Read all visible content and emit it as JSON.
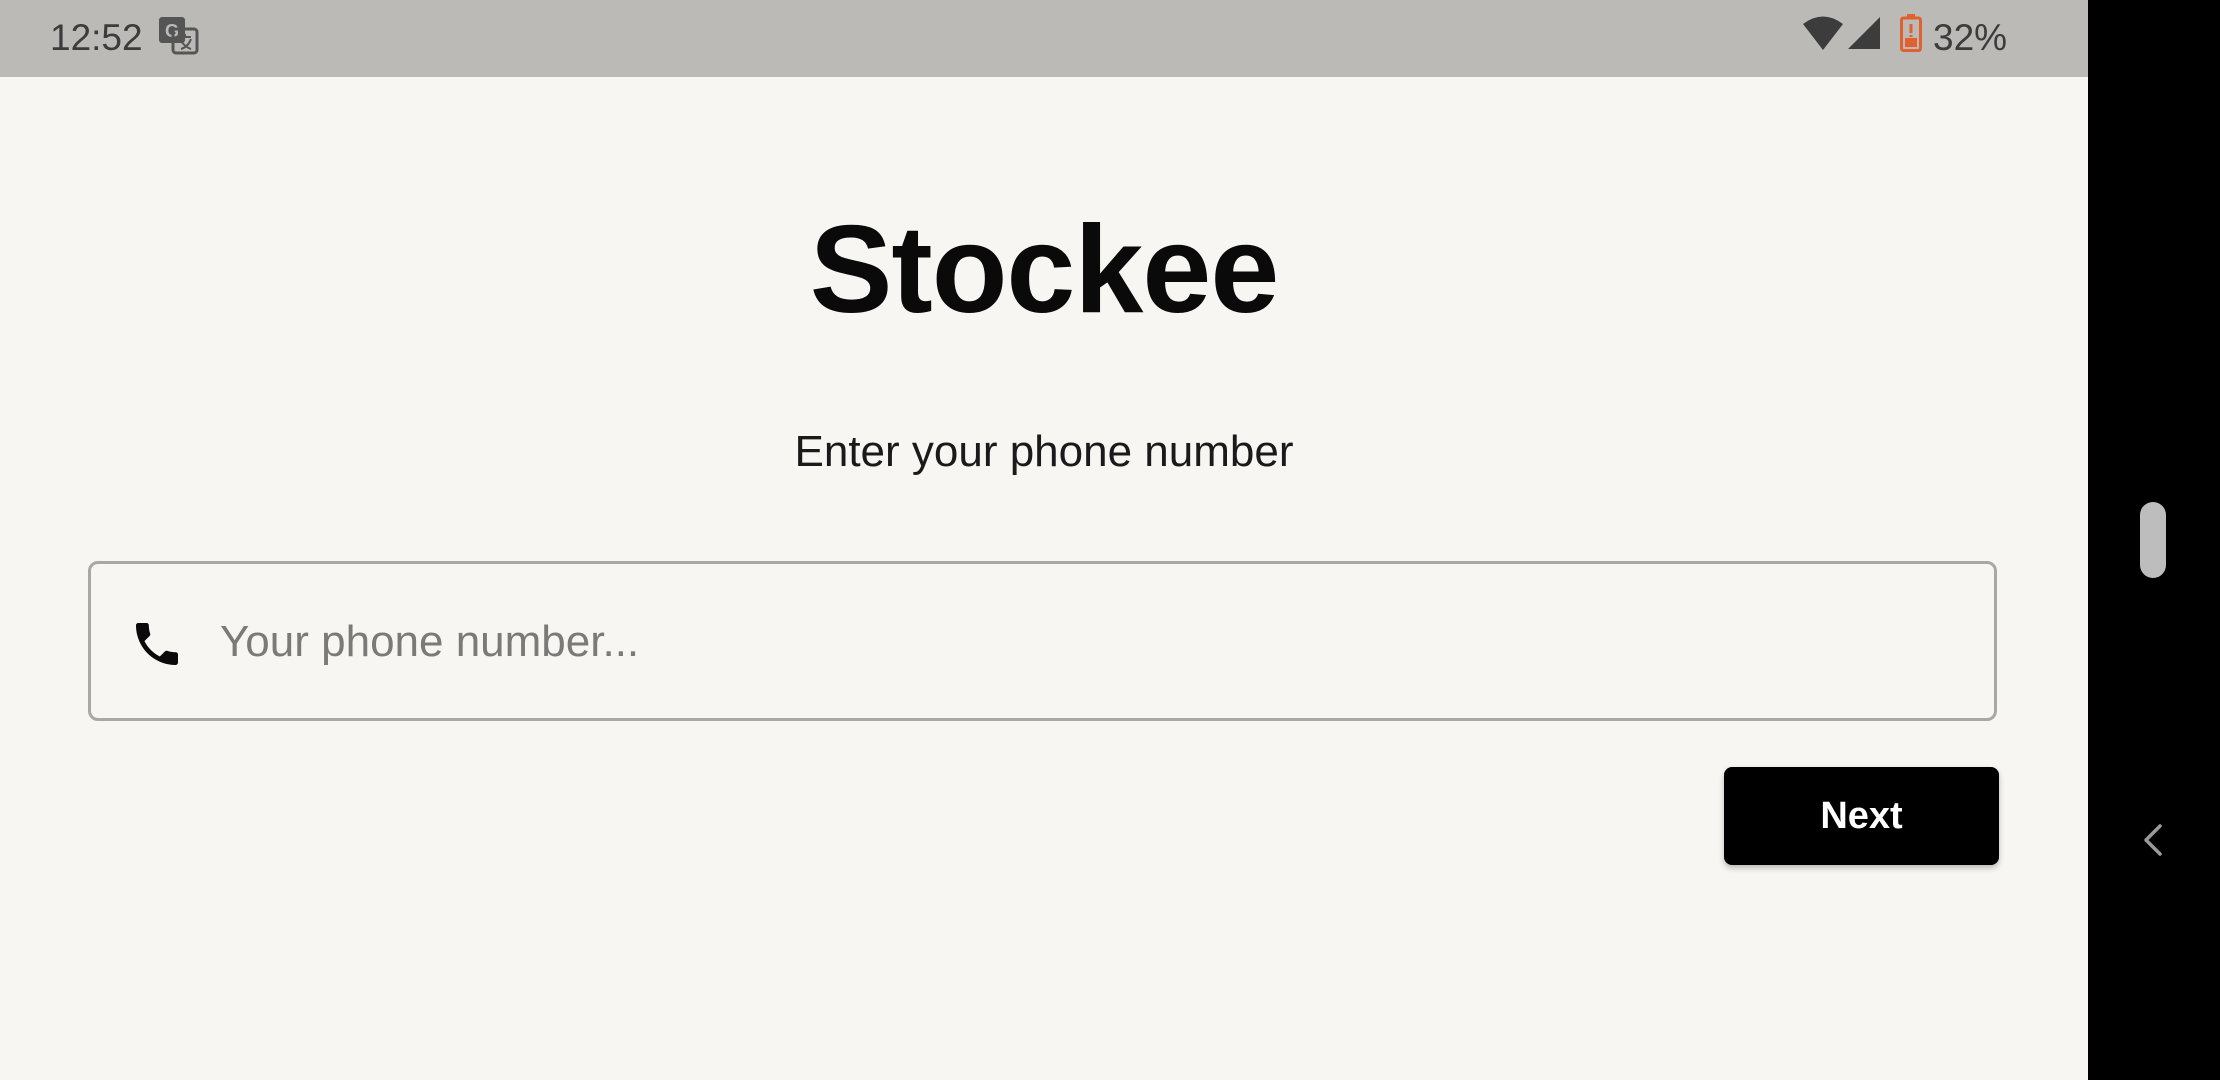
{
  "status_bar": {
    "time": "12:52",
    "battery_percent": "32%",
    "icons": [
      "translate-icon",
      "wifi-icon",
      "signal-icon",
      "battery-icon"
    ],
    "battery_color": "#e06030"
  },
  "app": {
    "title": "Stockee",
    "instruction": "Enter your phone number",
    "phone_field": {
      "placeholder": "Your phone number...",
      "value": "",
      "icon": "phone-icon"
    },
    "next_button_label": "Next"
  },
  "nav_bar": {
    "icons": [
      "back-icon"
    ]
  },
  "colors": {
    "background": "#f7f6f2",
    "status_bar": "#bbbab6",
    "button": "#000000",
    "button_text": "#ffffff"
  }
}
